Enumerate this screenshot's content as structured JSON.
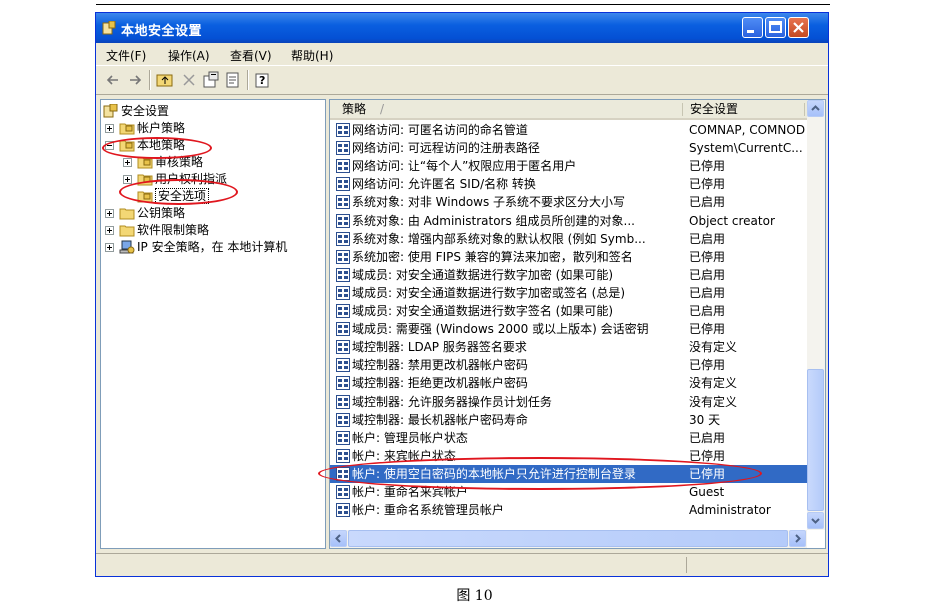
{
  "window": {
    "title": "本地安全设置"
  },
  "menu": [
    "文件(F)",
    "操作(A)",
    "查看(V)",
    "帮助(H)"
  ],
  "toolbar": [
    "back-icon",
    "forward-icon",
    "up-folder-icon",
    "delete-icon",
    "properties-icon",
    "export-icon",
    "help-icon"
  ],
  "tree": [
    {
      "label": "安全设置",
      "level": 0,
      "expander": "none",
      "icon": "security-settings-icon"
    },
    {
      "label": "帐户策略",
      "level": 1,
      "expander": "plus",
      "icon": "folder-icon"
    },
    {
      "label": "本地策略",
      "level": 1,
      "expander": "minus",
      "icon": "folder-open-icon"
    },
    {
      "label": "审核策略",
      "level": 2,
      "expander": "plus",
      "icon": "folder-icon"
    },
    {
      "label": "用户权利指派",
      "level": 2,
      "expander": "plus",
      "icon": "folder-icon"
    },
    {
      "label": "安全选项",
      "level": 2,
      "expander": "none",
      "icon": "folder-open-icon"
    },
    {
      "label": "公钥策略",
      "level": 1,
      "expander": "plus",
      "icon": "folder-icon"
    },
    {
      "label": "软件限制策略",
      "level": 1,
      "expander": "plus",
      "icon": "folder-icon"
    },
    {
      "label": "IP 安全策略，在 本地计算机",
      "level": 1,
      "expander": "plus",
      "icon": "ip-security-icon"
    }
  ],
  "list": {
    "columns": [
      "策略",
      "安全设置"
    ],
    "sort_indicator": "/",
    "rows": [
      {
        "policy": "网络访问: 可匿名访问的命名管道",
        "setting": "COMNAP, COMNODE, ..."
      },
      {
        "policy": "网络访问: 可远程访问的注册表路径",
        "setting": "System\\CurrentC..."
      },
      {
        "policy": "网络访问: 让“每个人”权限应用于匿名用户",
        "setting": "已停用"
      },
      {
        "policy": "网络访问: 允许匿名 SID/名称 转换",
        "setting": "已停用"
      },
      {
        "policy": "系统对象: 对非 Windows 子系统不要求区分大小写",
        "setting": "已启用"
      },
      {
        "policy": "系统对象: 由 Administrators 组成员所创建的对象...",
        "setting": "Object creator"
      },
      {
        "policy": "系统对象: 增强内部系统对象的默认权限 (例如 Symb...",
        "setting": "已启用"
      },
      {
        "policy": "系统加密: 使用 FIPS 兼容的算法来加密，散列和签名",
        "setting": "已停用"
      },
      {
        "policy": "域成员: 对安全通道数据进行数字加密 (如果可能)",
        "setting": "已启用"
      },
      {
        "policy": "域成员: 对安全通道数据进行数字加密或签名 (总是)",
        "setting": "已启用"
      },
      {
        "policy": "域成员: 对安全通道数据进行数字签名 (如果可能)",
        "setting": "已启用"
      },
      {
        "policy": "域成员: 需要强 (Windows 2000 或以上版本) 会话密钥",
        "setting": "已停用"
      },
      {
        "policy": "域控制器: LDAP 服务器签名要求",
        "setting": "没有定义"
      },
      {
        "policy": "域控制器: 禁用更改机器帐户密码",
        "setting": "已停用"
      },
      {
        "policy": "域控制器: 拒绝更改机器帐户密码",
        "setting": "没有定义"
      },
      {
        "policy": "域控制器: 允许服务器操作员计划任务",
        "setting": "没有定义"
      },
      {
        "policy": "域控制器: 最长机器帐户密码寿命",
        "setting": "30 天"
      },
      {
        "policy": "帐户: 管理员帐户状态",
        "setting": "已启用"
      },
      {
        "policy": "帐户: 来宾帐户状态",
        "setting": "已停用"
      },
      {
        "policy": "帐户: 使用空白密码的本地帐户只允许进行控制台登录",
        "setting": "已停用",
        "selected": true
      },
      {
        "policy": "帐户: 重命名来宾帐户",
        "setting": "Guest"
      },
      {
        "policy": "帐户: 重命名系统管理员帐户",
        "setting": "Administrator"
      }
    ]
  },
  "caption": "图 10"
}
